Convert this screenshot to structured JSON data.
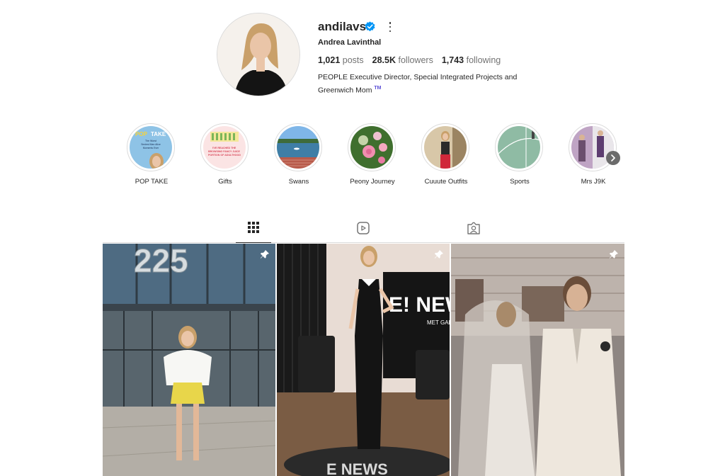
{
  "profile": {
    "username": "andilavs",
    "full_name": "Andrea Lavinthal",
    "stats": {
      "posts_count": "1,021",
      "posts_label": "posts",
      "followers_count": "28.5K",
      "followers_label": "followers",
      "following_count": "1,743",
      "following_label": "following"
    },
    "bio_line1": "PEOPLE Executive Director, Special Integrated Projects and",
    "bio_line2": "Greenwich Mom",
    "bio_tm": "TM"
  },
  "highlights": [
    {
      "label": "POP TAKE"
    },
    {
      "label": "Gifts"
    },
    {
      "label": "Swans"
    },
    {
      "label": "Peony Journey"
    },
    {
      "label": "Cuuute Outfits"
    },
    {
      "label": "Sports"
    },
    {
      "label": "Mrs J9K"
    }
  ],
  "highlight_art": {
    "pop_take_1": "POP",
    "pop_take_2": "TAKE",
    "pop_take_3": "The Worst",
    "pop_take_4": "Sexiest Man Alive",
    "pop_take_5": "Moments Ever",
    "gifts_text": "I'VE REACHED THE BROWSING FANCY JUICE PORTION OF ADULTHOOD"
  },
  "tabs": [
    {
      "name": "posts",
      "icon": "grid-icon"
    },
    {
      "name": "reels",
      "icon": "reels-icon"
    },
    {
      "name": "tagged",
      "icon": "tagged-icon"
    }
  ],
  "posts": [
    {
      "pinned": true,
      "sign_text": "225"
    },
    {
      "pinned": true,
      "sign_text": "E! NEWS",
      "sign_sub": "MET GALA",
      "floor_text": "E NEWS"
    },
    {
      "pinned": true
    }
  ],
  "colors": {
    "verified_blue": "#0095f6",
    "text": "#262626",
    "muted": "#737373",
    "border": "#dbdbdb"
  }
}
